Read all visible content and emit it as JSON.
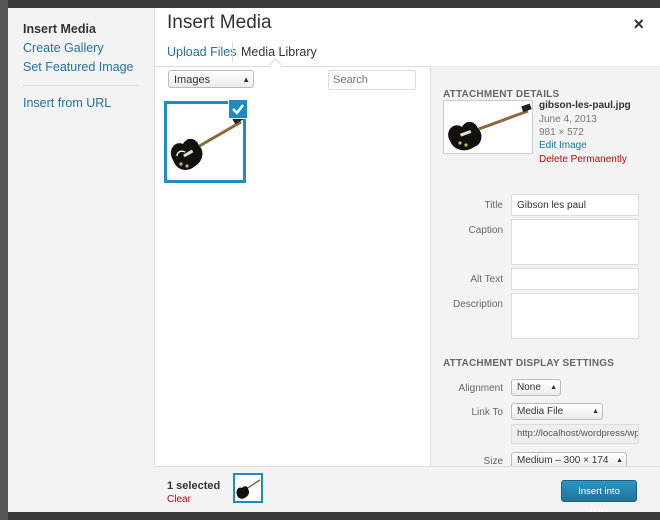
{
  "menu": {
    "items": [
      {
        "label": "Insert Media",
        "active": true
      },
      {
        "label": "Create Gallery",
        "active": false
      },
      {
        "label": "Set Featured Image",
        "active": false
      }
    ],
    "insert_url_label": "Insert from URL"
  },
  "frame": {
    "title": "Insert Media",
    "close_glyph": "×"
  },
  "router": {
    "upload_label": "Upload Files",
    "library_label": "Media Library"
  },
  "toolbar": {
    "filter_value": "Images",
    "search_placeholder": "Search"
  },
  "attachment": {
    "header": "ATTACHMENT DETAILS",
    "filename": "gibson-les-paul.jpg",
    "date": "June 4, 2013",
    "dimensions": "981 × 572",
    "edit_label": "Edit Image",
    "delete_label": "Delete Permanently",
    "title_label": "Title",
    "title_value": "Gibson les paul",
    "caption_label": "Caption",
    "caption_value": "",
    "alt_label": "Alt Text",
    "alt_value": "",
    "description_label": "Description",
    "description_value": ""
  },
  "display_settings": {
    "header": "ATTACHMENT DISPLAY SETTINGS",
    "alignment_label": "Alignment",
    "alignment_value": "None",
    "link_label": "Link To",
    "link_value": "Media File",
    "link_url": "http://localhost/wordpress/wp",
    "size_label": "Size",
    "size_value": "Medium – 300 × 174"
  },
  "bottom": {
    "selected_text": "1 selected",
    "clear_label": "Clear",
    "insert_label": "Insert into post"
  },
  "colors": {
    "accent": "#1e8cbe",
    "link": "#21759b",
    "delete": "#bc0b0b"
  }
}
